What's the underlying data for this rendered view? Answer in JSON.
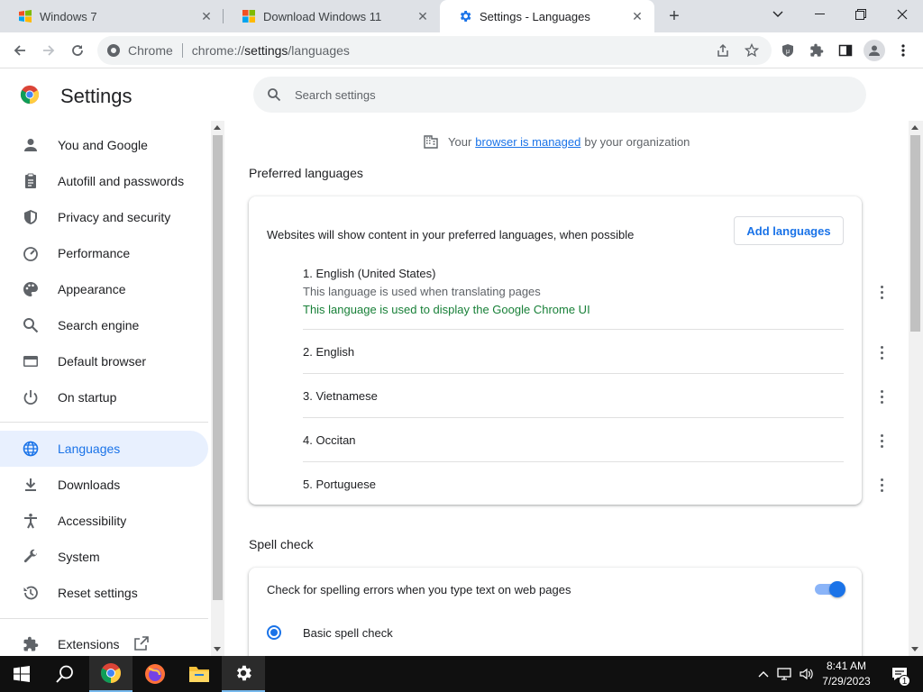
{
  "tabs": [
    {
      "title": "Windows 7",
      "active": false
    },
    {
      "title": "Download Windows 11",
      "active": false
    },
    {
      "title": "Settings - Languages",
      "active": true
    }
  ],
  "omnibox": {
    "site_name": "Chrome",
    "url_scheme": "chrome://",
    "url_host": "settings",
    "url_path": "/languages"
  },
  "settings": {
    "title": "Settings",
    "search_placeholder": "Search settings"
  },
  "sidebar": {
    "items": [
      {
        "label": "You and Google",
        "icon": "person-icon"
      },
      {
        "label": "Autofill and passwords",
        "icon": "clipboard-icon"
      },
      {
        "label": "Privacy and security",
        "icon": "shield-icon"
      },
      {
        "label": "Performance",
        "icon": "speedometer-icon"
      },
      {
        "label": "Appearance",
        "icon": "palette-icon"
      },
      {
        "label": "Search engine",
        "icon": "search-icon"
      },
      {
        "label": "Default browser",
        "icon": "browser-window-icon"
      },
      {
        "label": "On startup",
        "icon": "power-icon"
      },
      {
        "label": "Languages",
        "icon": "globe-icon",
        "selected": true
      },
      {
        "label": "Downloads",
        "icon": "download-icon"
      },
      {
        "label": "Accessibility",
        "icon": "accessibility-icon"
      },
      {
        "label": "System",
        "icon": "wrench-icon"
      },
      {
        "label": "Reset settings",
        "icon": "history-icon"
      },
      {
        "label": "Extensions",
        "icon": "puzzle-icon"
      }
    ]
  },
  "managed": {
    "prefix": "Your",
    "link": "browser is managed",
    "suffix": "by your organization"
  },
  "preferred": {
    "title": "Preferred languages",
    "description": "Websites will show content in your preferred languages, when possible",
    "add_button": "Add languages",
    "languages": [
      {
        "label": "1. English (United States)",
        "note1": "This language is used when translating pages",
        "note2": "This language is used to display the Google Chrome UI"
      },
      {
        "label": "2. English"
      },
      {
        "label": "3. Vietnamese"
      },
      {
        "label": "4. Occitan"
      },
      {
        "label": "5. Portuguese"
      }
    ]
  },
  "spellcheck": {
    "title": "Spell check",
    "toggle_label": "Check for spelling errors when you type text on web pages",
    "toggle_on": true,
    "option_basic": "Basic spell check"
  },
  "clock": {
    "time": "8:41 AM",
    "date": "7/29/2023"
  },
  "notifications": {
    "count": "1"
  },
  "colors": {
    "accent": "#1a73e8",
    "selected_bg": "#e8f0fe",
    "green_note": "#188038"
  }
}
